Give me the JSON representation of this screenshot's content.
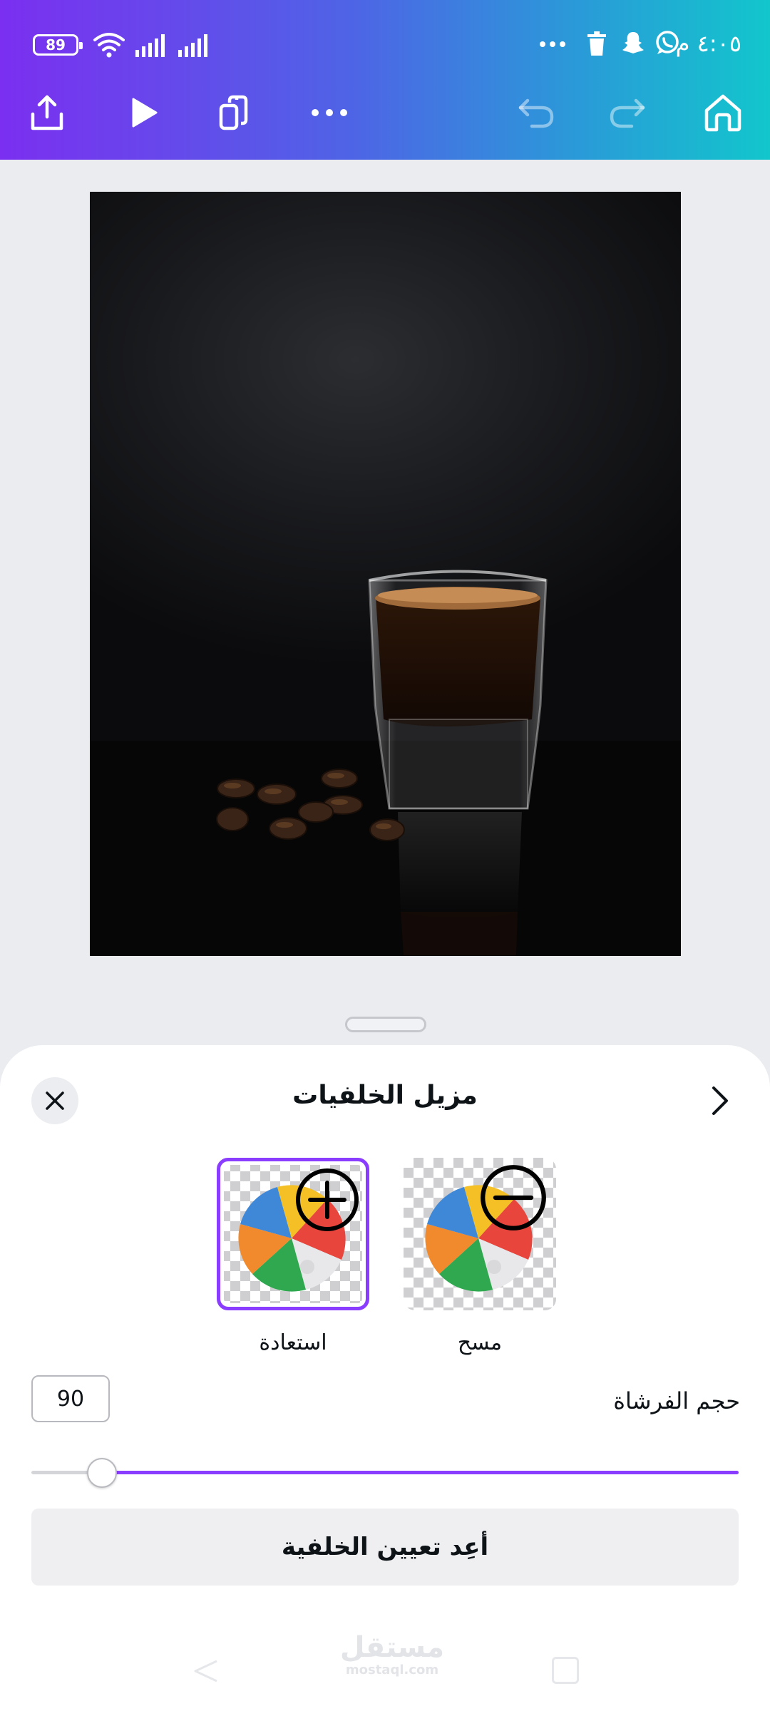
{
  "status_bar": {
    "battery": "89",
    "time": "٤:٠٥ م",
    "icons": [
      "wifi-icon",
      "signal-icon",
      "signal-icon",
      "more-dots-icon",
      "trash-icon",
      "snapchat-icon",
      "whatsapp-icon"
    ]
  },
  "toolbar": {
    "left_icons": [
      "share-icon",
      "play-icon",
      "copy-pages-icon",
      "more-icon"
    ],
    "right_icons": [
      "undo-icon",
      "redo-icon",
      "home-icon"
    ],
    "gradient_colors": [
      "#7b2ff0",
      "#4f63e6",
      "#2a9ad8",
      "#12c6cc"
    ]
  },
  "panel": {
    "title": "مزيل الخلفيات",
    "close_icon": "close-icon",
    "forward_icon": "chevron-right-icon",
    "tools": [
      {
        "label": "استعادة",
        "icon": "plus-circle-icon",
        "selected": true
      },
      {
        "label": "مسح",
        "icon": "minus-circle-icon",
        "selected": false
      }
    ],
    "brush_size_label": "حجم الفرشاة",
    "brush_size_value": "90",
    "brush_slider_fraction": 0.1,
    "reset_button": "أعِد تعيين الخلفية",
    "accent_color": "#8b3dff"
  },
  "watermark": {
    "main": "مستقل",
    "sub": "mostaql.com"
  }
}
